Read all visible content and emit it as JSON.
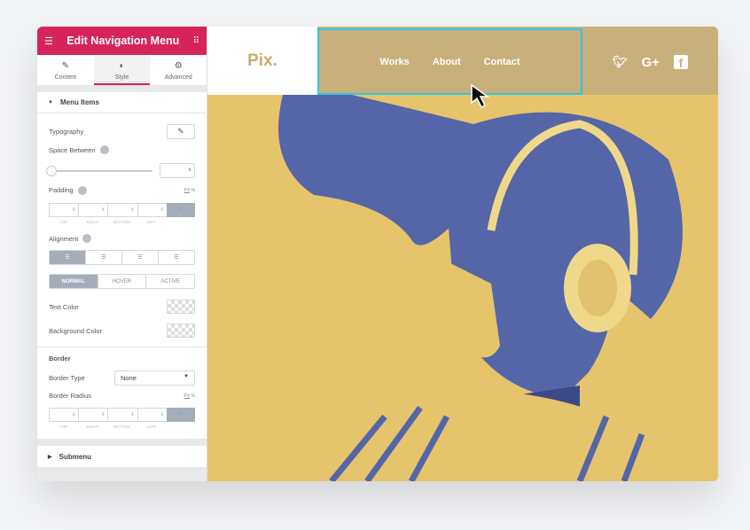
{
  "panel": {
    "title": "Edit Navigation Menu",
    "tabs": [
      {
        "label": "Content",
        "icon": "pencil-icon"
      },
      {
        "label": "Style",
        "icon": "contrast-icon"
      },
      {
        "label": "Advanced",
        "icon": "gear-icon"
      }
    ],
    "section": "Menu Items",
    "typography": "Typography",
    "space_between": "Space Between",
    "padding": "Padding",
    "unit_px": "PX",
    "unit_pct": "%",
    "dims": [
      "TOP",
      "RIGHT",
      "BOTTOM",
      "LEFT"
    ],
    "alignment": "Alignment",
    "states": [
      "NORMAL",
      "HOVER",
      "ACTIVE"
    ],
    "text_color": "Text Color",
    "bg_color": "Background Color",
    "border": "Border",
    "border_type": "Border Type",
    "border_type_value": "None",
    "border_radius": "Border Radius",
    "submenu": "Submenu",
    "accent": "#d6245a"
  },
  "site": {
    "logo": "Pix.",
    "nav": [
      "Works",
      "About",
      "Contact"
    ],
    "social": [
      "twitter-icon",
      "google-plus-icon",
      "facebook-icon"
    ],
    "social_text": [
      "🐦",
      "G+",
      "f"
    ],
    "highlight": "#2fc8e0",
    "duotone": [
      "#e6c46c",
      "#5466a8"
    ]
  }
}
